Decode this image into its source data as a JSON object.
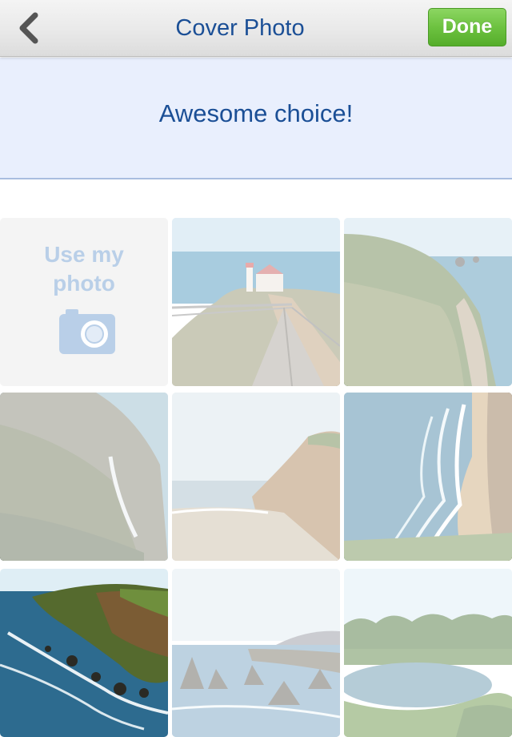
{
  "navbar": {
    "title": "Cover Photo",
    "done_label": "Done",
    "back_icon": "chevron-left-icon"
  },
  "banner": {
    "message": "Awesome choice!"
  },
  "grid": {
    "use_my_photo_label_line1": "Use my",
    "use_my_photo_label_line2": "photo",
    "camera_icon": "camera-icon",
    "photos": [
      {
        "subject": "lighthouse-walkway",
        "selected": false
      },
      {
        "subject": "coastal-cliffs",
        "selected": false
      },
      {
        "subject": "cliff-waterfall",
        "selected": false
      },
      {
        "subject": "beach-headland",
        "selected": false
      },
      {
        "subject": "aerial-surf-beach",
        "selected": false
      },
      {
        "subject": "rocky-coastline",
        "selected": true
      },
      {
        "subject": "sea-stacks",
        "selected": false
      },
      {
        "subject": "forest-lake",
        "selected": false
      }
    ]
  },
  "colors": {
    "accent_blue": "#1b4f96",
    "done_green": "#6dc240",
    "banner_bg": "#e9effd",
    "camera_blue": "#b9cfe8"
  }
}
